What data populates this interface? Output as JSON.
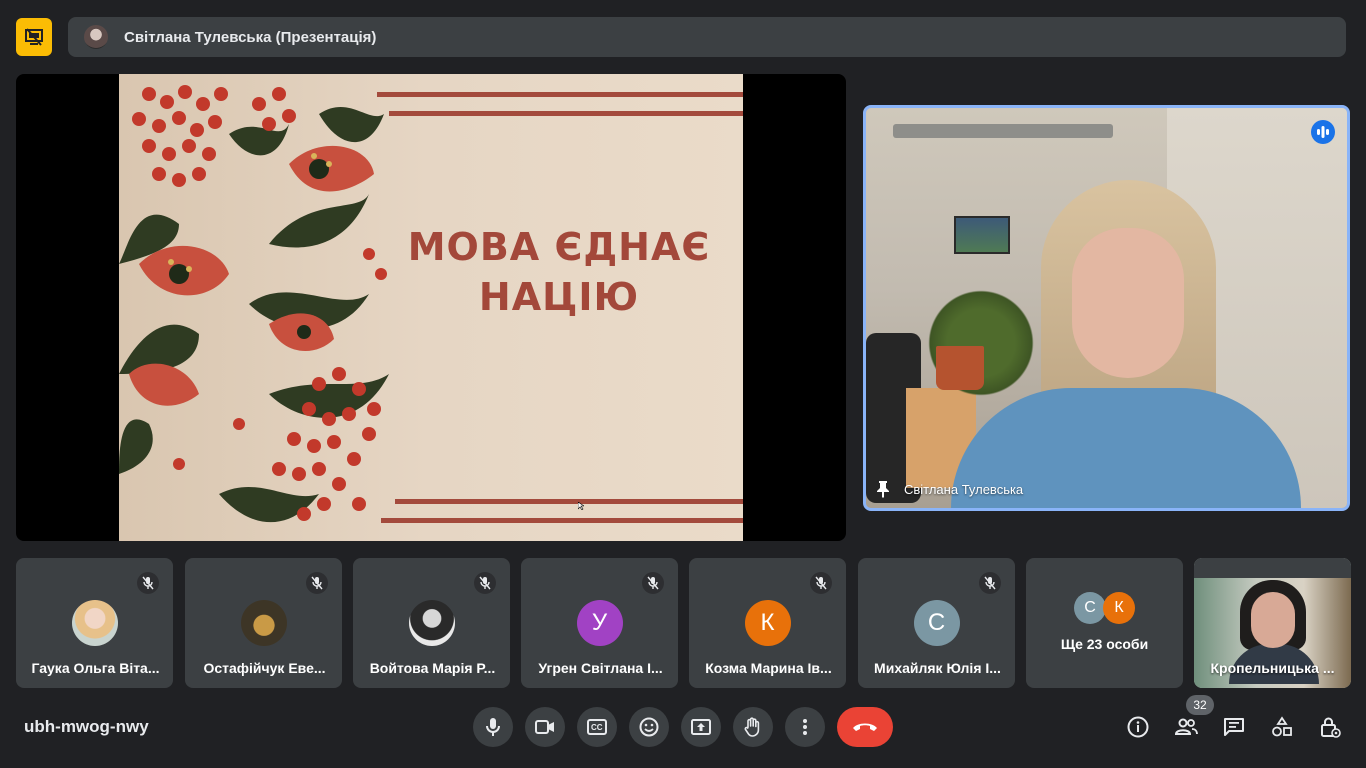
{
  "header": {
    "presenter_title": "Світлана Тулевська (Презентація)",
    "presenting_icon": "presentation-off-icon",
    "accent_color": "#fbbc04"
  },
  "slide": {
    "title_line1": "МОВА ЄДНАЄ",
    "title_line2": "НАЦІЮ",
    "title_color": "#a3483a"
  },
  "speaker": {
    "name": "Світлана Тулевська",
    "pin_icon": "pin-icon",
    "speaking_icon": "speaking-indicator-icon",
    "highlight_color": "#8ab4f8"
  },
  "participants": [
    {
      "name": "Гаука Ольга Віта...",
      "avatar_type": "photo",
      "muted": true
    },
    {
      "name": "Остафійчук Еве...",
      "avatar_type": "photo",
      "muted": true
    },
    {
      "name": "Войтова Марія Р...",
      "avatar_type": "photo",
      "muted": true
    },
    {
      "name": "Угрен Світлана І...",
      "avatar_letter": "У",
      "avatar_color": "#a142c4",
      "muted": true
    },
    {
      "name": "Козма Марина Ів...",
      "avatar_letter": "К",
      "avatar_color": "#e8710a",
      "muted": true
    },
    {
      "name": "Михайляк Юлія І...",
      "avatar_letter": "С",
      "avatar_color": "#7b97a3",
      "muted": true
    }
  ],
  "more_tile": {
    "label": "Ще 23 особи",
    "mini_avatars": [
      {
        "letter": "С",
        "color": "#7b97a3"
      },
      {
        "letter": "К",
        "color": "#e8710a"
      }
    ]
  },
  "video_participant": {
    "name": "Кропельницька ..."
  },
  "bottom_bar": {
    "meeting_code": "ubh-mwog-nwy",
    "controls": [
      "microphone-icon",
      "camera-icon",
      "captions-icon",
      "emoji-icon",
      "present-screen-icon",
      "raise-hand-icon",
      "more-options-icon",
      "hangup-icon"
    ],
    "right_controls": [
      "info-icon",
      "people-icon",
      "chat-icon",
      "activities-icon",
      "host-controls-icon"
    ],
    "people_count": "32",
    "hangup_color": "#ea4335"
  }
}
